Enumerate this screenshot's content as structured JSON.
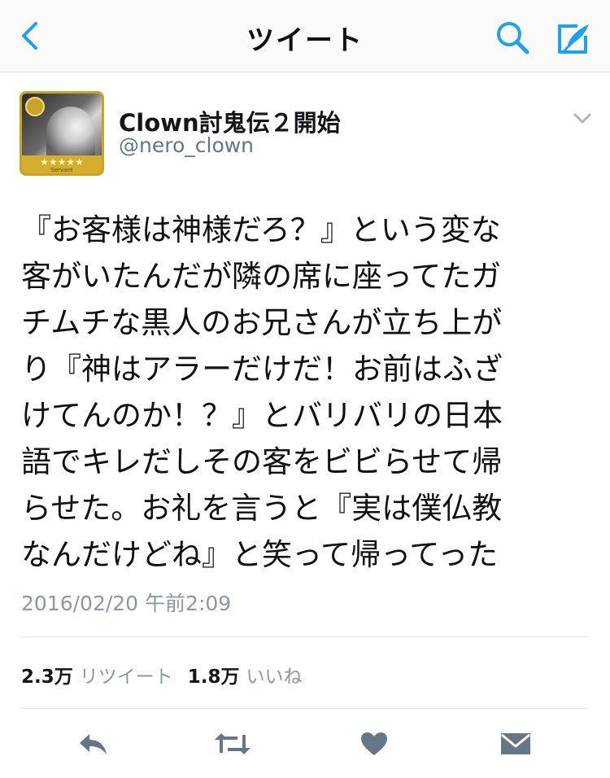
{
  "colors": {
    "accent": "#1DA1F2",
    "icon_gray": "#657786",
    "text_dark": "#14171a",
    "text_muted": "#8899a6",
    "divider": "#e1e8ed"
  },
  "nav": {
    "title": "ツイート",
    "back_icon": "chevron-left-icon",
    "search_icon": "search-icon",
    "compose_icon": "compose-icon"
  },
  "tweet": {
    "author": {
      "display_name": "Clown討鬼伝２開始",
      "handle": "@nero_clown",
      "avatar_stars": "★★★★★",
      "avatar_caption": "Servant"
    },
    "text_lines": [
      "『お客様は神様だろ？』という変な",
      "客がいたんだが隣の席に座ってたガ",
      "チムチな黒人のお兄さんが立ち上が",
      "り『神はアラーだけだ！お前はふざ",
      "けてんのか！？』とバリバリの日本",
      "語でキレだしその客をビビらせて帰",
      "らせた。お礼を言うと『実は僕仏教",
      "なんだけどね』と笑って帰ってった"
    ],
    "timestamp": "2016/02/20 午前2:09",
    "retweet_count": "2.3万",
    "retweet_label": "リツイート",
    "like_count": "1.8万",
    "like_label": "いいね"
  },
  "actions": {
    "reply_icon": "reply-icon",
    "retweet_icon": "retweet-icon",
    "like_icon": "heart-icon",
    "dm_icon": "envelope-icon"
  }
}
